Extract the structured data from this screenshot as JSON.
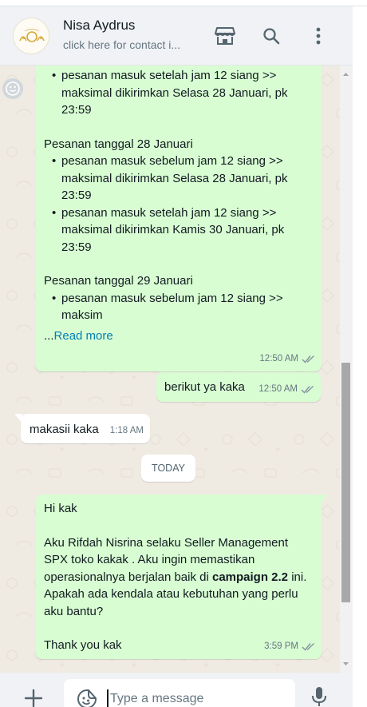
{
  "header": {
    "contact_name": "Nisa Aydrus",
    "contact_subtitle": "click here for contact i...",
    "icons": [
      "shop-icon",
      "search-icon",
      "more-vert-icon"
    ]
  },
  "messages": {
    "m1": {
      "lines_top": [
        "pesanan masuk setelah jam 12 siang >> maksimal dikirimkan Selasa 28 Januari, pk 23:59"
      ],
      "section_a_title": "Pesanan tanggal 28 Januari",
      "section_a_items": [
        "pesanan masuk sebelum jam 12 siang >> maksimal dikirimkan Selasa 28 Januari, pk 23:59",
        "pesanan masuk setelah jam 12 siang >> maksimal dikirimkan Kamis 30 Januari, pk 23:59"
      ],
      "section_b_title": "Pesanan tanggal 29 Januari",
      "section_b_items": [
        "pesanan masuk sebelum jam 12 siang >> maksim"
      ],
      "ellipsis": "...",
      "read_more": "Read more",
      "time": "12:50 AM"
    },
    "m2": {
      "text": "berikut ya kaka",
      "time": "12:50 AM"
    },
    "m3": {
      "text": "makasii kaka",
      "time": "1:18 AM"
    },
    "day_divider": "TODAY",
    "m4": {
      "greeting": "Hi kak",
      "body_before_bold": "Aku Rifdah Nisrina selaku Seller Management SPX toko kakak . Aku ingin memastikan operasionalnya berjalan baik di ",
      "body_bold": "campaign 2.2",
      "body_after_bold": " ini. Apakah ada kendala atau kebutuhan yang perlu aku bantu?",
      "closing": "Thank you kak",
      "time": "3:59 PM"
    }
  },
  "composer": {
    "placeholder": "Type a message"
  },
  "colors": {
    "outgoing_bubble": "#d9fdd3",
    "incoming_bubble": "#ffffff",
    "chat_background": "#efeae2",
    "read_more_link": "#027eb5",
    "header_background": "#f0f2f5"
  }
}
